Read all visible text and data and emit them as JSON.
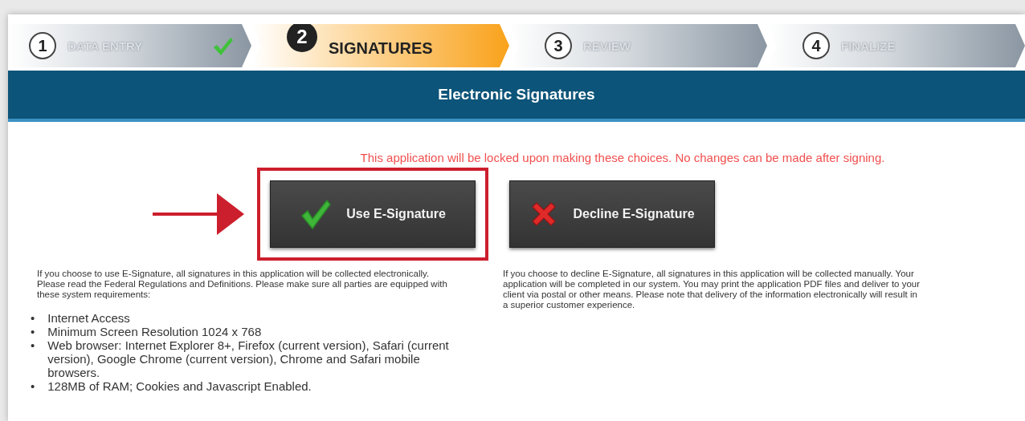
{
  "steps": [
    {
      "number": "1",
      "label": "DATA ENTRY",
      "done": true,
      "selected": false
    },
    {
      "number": "2",
      "label": "SIGNATURES",
      "done": false,
      "selected": true
    },
    {
      "number": "3",
      "label": "REVIEW",
      "done": false,
      "selected": false
    },
    {
      "number": "4",
      "label": "FINALIZE",
      "done": false,
      "selected": false
    }
  ],
  "header": {
    "title": "Electronic Signatures"
  },
  "warning": "This application will be locked upon making these choices. No changes can be made after signing.",
  "choices": [
    {
      "kind": "accept",
      "label": "Use E-Signature",
      "highlighted": true,
      "note": "If you choose to use E-Signature, all signatures in this application will be collected electronically. Please read the Federal Regulations and Definitions. Please make sure all parties are equipped with these system requirements:",
      "requirements": [
        {
          "bullet": "•",
          "text": "Internet Access"
        },
        {
          "bullet": "•",
          "text": "Minimum Screen Resolution 1024 x 768"
        },
        {
          "bullet": "•",
          "text": "Web browser: Internet Explorer 8+, Firefox (current version), Safari (current version), Google Chrome (current version), Chrome and Safari mobile browsers."
        },
        {
          "bullet": "•",
          "text": "128MB of RAM; Cookies and Javascript Enabled."
        }
      ]
    },
    {
      "kind": "decline",
      "label": "Decline E-Signature",
      "highlighted": false,
      "note": "If you choose to decline E-Signature, all signatures in this application will be collected manually. Your application will be completed in our system. You may print the application PDF files and deliver to your client via postal or other means. Please note that delivery of the information electronically will result in a superior customer experience."
    }
  ]
}
